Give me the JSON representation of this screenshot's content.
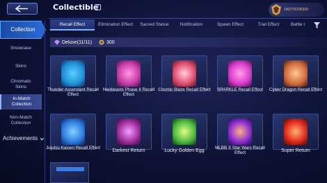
{
  "header": {
    "title": "Collectible",
    "currency_amount": "190270/200300"
  },
  "sidebar": {
    "items": [
      {
        "label": "Collection"
      },
      {
        "label": "Showcase"
      },
      {
        "label": "Skins"
      },
      {
        "label": "Chromatic Skins"
      },
      {
        "label": "In-Match Collection"
      },
      {
        "label": "Non-Match Collection"
      },
      {
        "label": "Achievements"
      }
    ]
  },
  "tabs": [
    {
      "label": "Recall Effect"
    },
    {
      "label": "Elimination Effect"
    },
    {
      "label": "Sacred Statue"
    },
    {
      "label": "Notification"
    },
    {
      "label": "Spawn Effect"
    },
    {
      "label": "Trail Effect"
    },
    {
      "label": "Battle I"
    }
  ],
  "section": {
    "label": "Deluxe(11/11)",
    "count": "300"
  },
  "items": [
    {
      "name": "Thunder Ascendant Recall Effect",
      "color": "#1f8fd8"
    },
    {
      "name": "Neobeasts Phase II Recall Effect",
      "color": "#c83aa6"
    },
    {
      "name": "Cosmic Blaze Recall Effect",
      "color": "#e04a6a"
    },
    {
      "name": "SPARKLE Recall Effect",
      "color": "#d83ac8"
    },
    {
      "name": "Cyber Dragon Recall Effect",
      "color": "#d06a3a"
    },
    {
      "name": "Jujutsu Kaisen Recall Effect",
      "color": "#2a7ae0"
    },
    {
      "name": "Darkest Return",
      "color": "#a02a9a"
    },
    {
      "name": "Lucky Golden Egg",
      "color": "#4ab83a"
    },
    {
      "name": "MLBB X Star Wars Recall Effect",
      "color": "#8a2ad0"
    },
    {
      "name": "Super Return",
      "color": "#e0281a"
    }
  ]
}
